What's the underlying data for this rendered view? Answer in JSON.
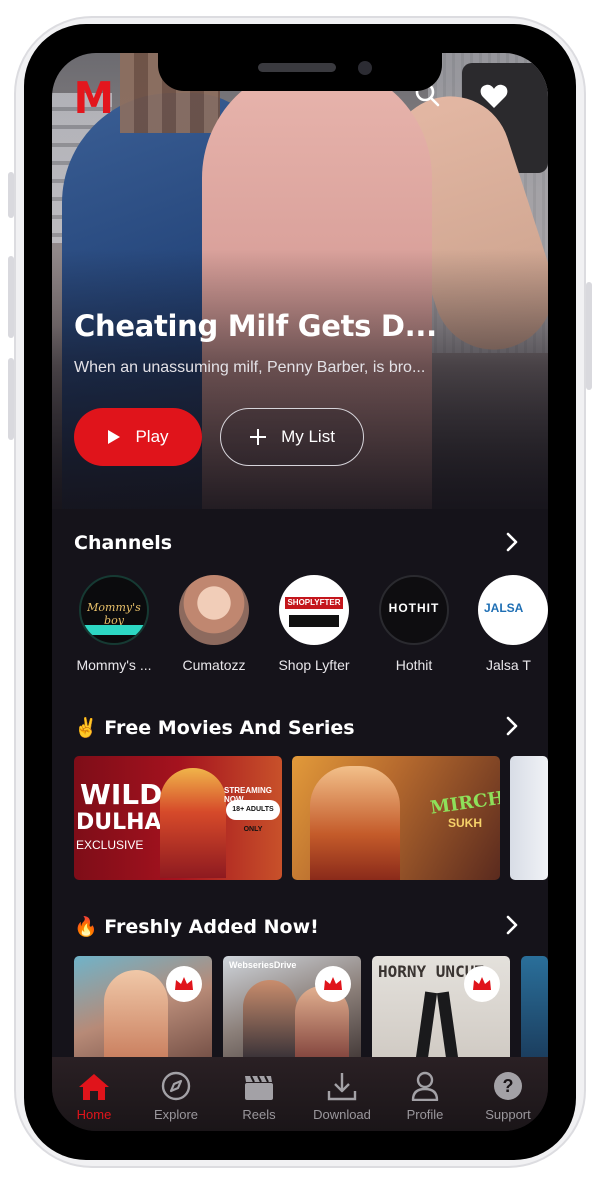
{
  "app": {
    "logo": "M"
  },
  "header": {
    "search_icon": "search-icon",
    "favorite_icon": "heart-icon"
  },
  "hero": {
    "title": "Cheating Milf Gets D...",
    "description": "When an unassuming milf, Penny Barber, is bro...",
    "play_label": "Play",
    "mylist_label": "My List"
  },
  "channels": {
    "title": "Channels",
    "items": [
      {
        "name": "Mommy's ...",
        "logo_text": "Mommy's boy"
      },
      {
        "name": "Cumatozz",
        "logo_text": ""
      },
      {
        "name": "Shop Lyfter",
        "logo_text": "SHOPLYFTER"
      },
      {
        "name": "Hothit",
        "logo_text": "HOTHIT"
      },
      {
        "name": "Jalsa T",
        "logo_text": "JALSA"
      }
    ]
  },
  "free": {
    "title": "✌️ Free Movies And Series",
    "cards": [
      {
        "line1": "WILD",
        "line2": "DULHAN",
        "line3": "EXCLUSIVE",
        "badge": "18+ ADULTS ONLY",
        "tag": "STREAMING NOW"
      },
      {
        "title": "MIRCHI",
        "subtitle": "SUKH"
      }
    ]
  },
  "fresh": {
    "title": "🔥 Freshly Added Now!",
    "cards": [
      {
        "label": ""
      },
      {
        "label": "WebseriesDrive"
      },
      {
        "label": "HORNY UNCUT"
      }
    ]
  },
  "nav": {
    "items": [
      {
        "label": "Home",
        "icon": "home-icon",
        "active": true
      },
      {
        "label": "Explore",
        "icon": "compass-icon",
        "active": false
      },
      {
        "label": "Reels",
        "icon": "clapperboard-icon",
        "active": false
      },
      {
        "label": "Download",
        "icon": "download-icon",
        "active": false
      },
      {
        "label": "Profile",
        "icon": "user-icon",
        "active": false
      },
      {
        "label": "Support",
        "icon": "help-icon",
        "active": false
      }
    ]
  },
  "colors": {
    "accent": "#e0141b",
    "background": "#15131a"
  }
}
